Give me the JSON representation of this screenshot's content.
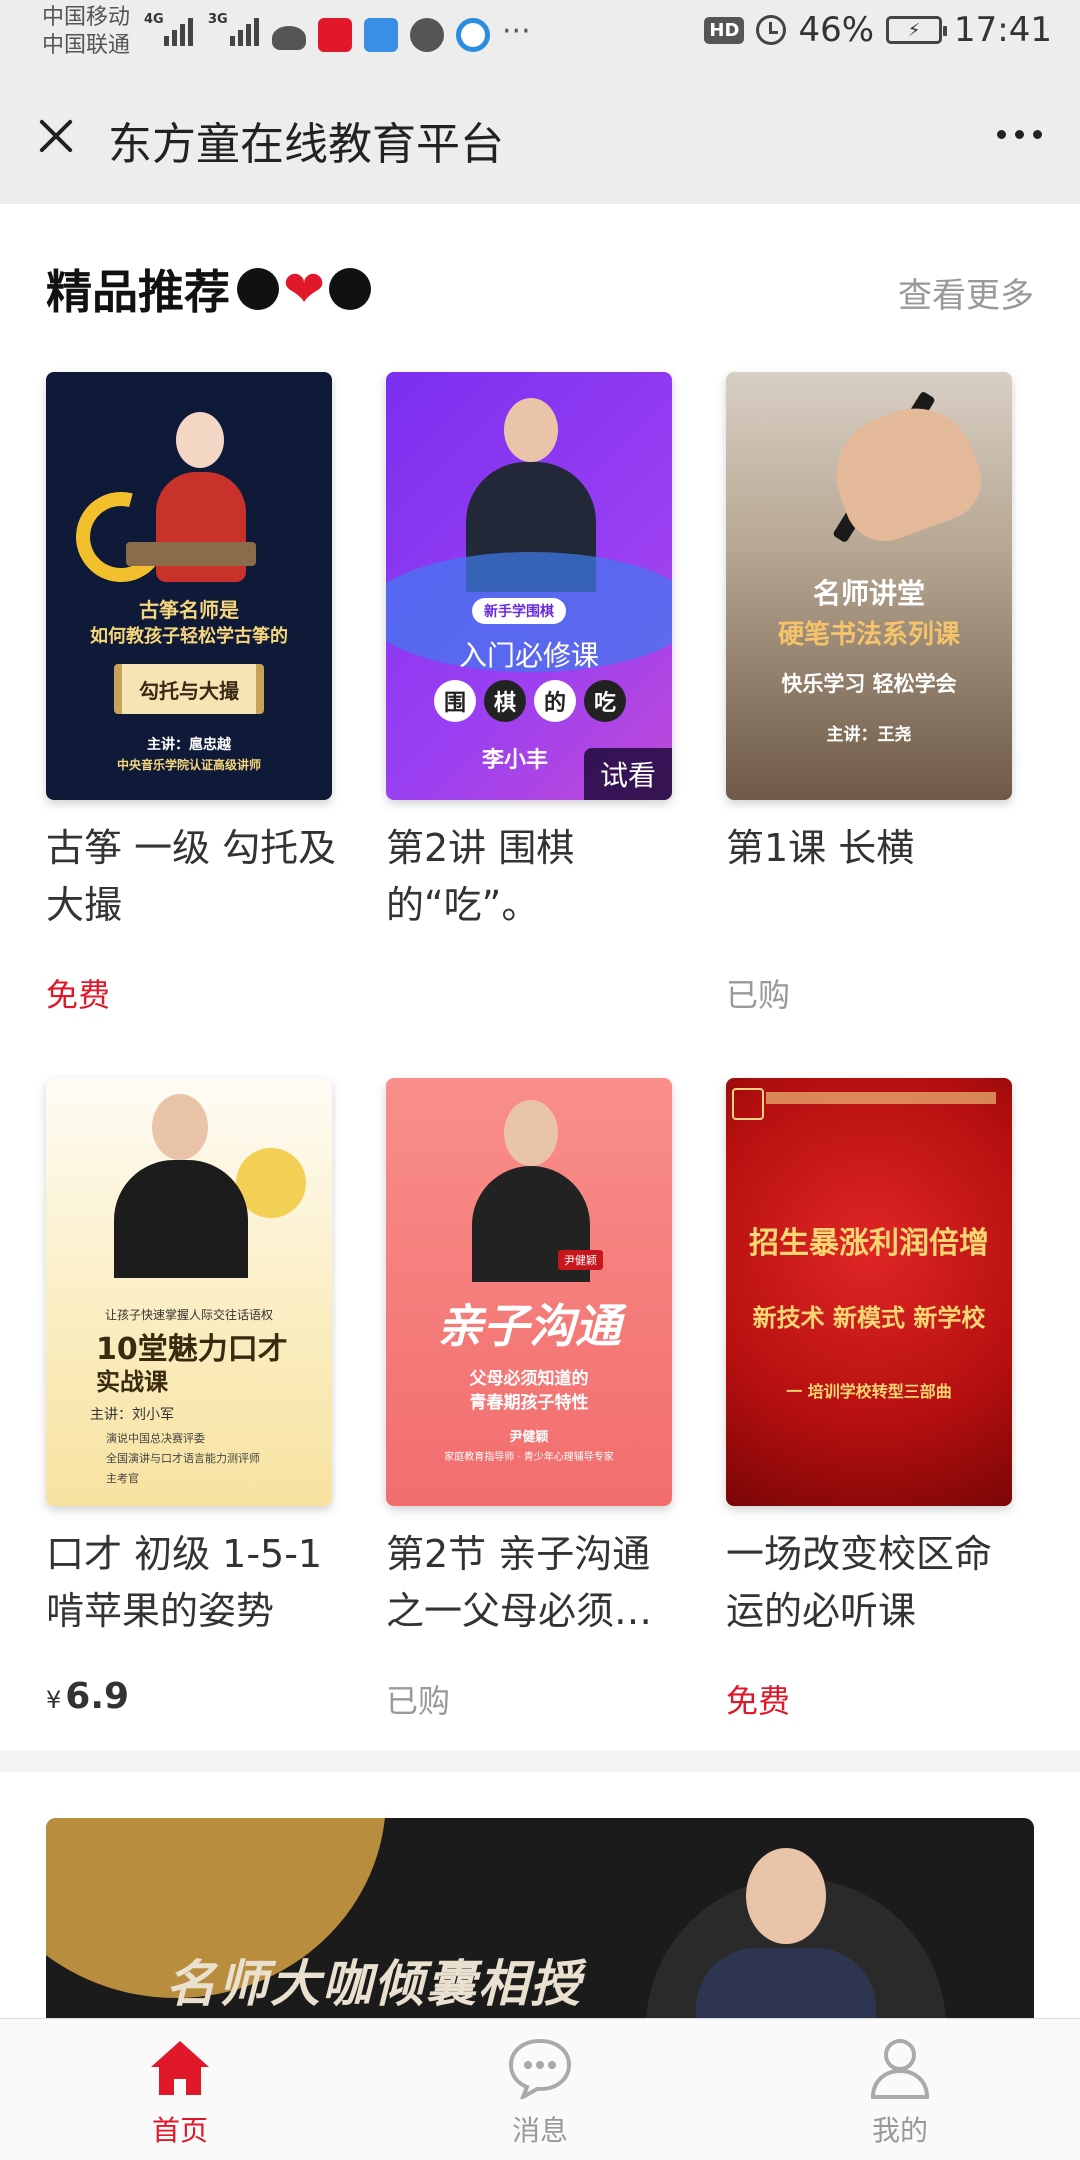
{
  "status_bar": {
    "carrier_1": "中国移动",
    "carrier_2": "中国联通",
    "net_1": "4G",
    "net_2": "3G",
    "hd": "HD",
    "battery": "46%",
    "time": "17:41"
  },
  "header": {
    "title": "东方童在线教育平台"
  },
  "section": {
    "title": "精品推荐",
    "see_more": "查看更多"
  },
  "courses": [
    {
      "title": "古筝 一级 勾托及大撮",
      "price": "免费",
      "cover_lines": [
        "古筝名师是",
        "如何教孩子轻松学古筝的",
        "勾托与大撮",
        "主讲：扈忠越",
        "中央音乐学院认证高级讲师"
      ]
    },
    {
      "title": "第2讲 围棋的“吃”。",
      "price": "",
      "cover_lines": [
        "新手学围棋",
        "入门必修课",
        "围",
        "棋",
        "的",
        "吃",
        "李小丰"
      ],
      "badge": "试看"
    },
    {
      "title": "第1课 长横",
      "price": "已购",
      "cover_lines": [
        "名师讲堂",
        "硬笔书法系列课",
        "快乐学习 轻松学会",
        "主讲：王尧"
      ]
    },
    {
      "title": "口才 初级 1-5-1 啃苹果的姿势",
      "price": "6.9",
      "currency": "¥",
      "cover_lines": [
        "让孩子快速掌握人际交往话语权",
        "10堂魅力口才",
        "实战课",
        "主讲：刘小军",
        "演说中国总决赛评委",
        "全国演讲与口才语言能力测评师",
        "主考官"
      ]
    },
    {
      "title": "第2节 亲子沟通之一父母必须…",
      "price": "已购",
      "cover_lines": [
        "尹健颖",
        "亲子沟通",
        "父母必须知道的",
        "青春期孩子特性",
        "尹健颖",
        "家庭教育指导师 · 青少年心理辅导专家"
      ]
    },
    {
      "title": "一场改变校区命运的必听课",
      "price": "免费",
      "cover_lines": [
        "招生暴涨利润倍增",
        "新技术 新模式 新学校",
        "一 培训学校转型三部曲"
      ]
    }
  ],
  "banner": {
    "text": "名师大咖倾囊相授"
  },
  "nav": {
    "home": "首页",
    "messages": "消息",
    "mine": "我的"
  },
  "colors": {
    "accent": "#e0182a",
    "header_bg": "#ededed"
  }
}
